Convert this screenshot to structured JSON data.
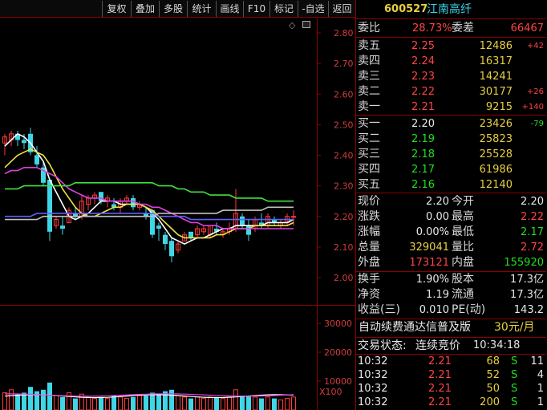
{
  "toolbar": {
    "buttons": [
      "复权",
      "叠加",
      "多股",
      "统计",
      "画线",
      "F10",
      "标记",
      "-自选",
      "返回"
    ]
  },
  "chart_data": {
    "type": "candlestick",
    "price_axis": [
      "2.80",
      "2.70",
      "2.60",
      "2.50",
      "2.40",
      "2.30",
      "2.20",
      "2.10",
      "2.00"
    ],
    "ylim": [
      1.95,
      2.84
    ],
    "volume_axis": [
      "30000",
      "20000",
      "10000"
    ],
    "volume_unit": "X100",
    "volume_max": 35000,
    "candles": [
      {
        "o": 2.44,
        "h": 2.47,
        "l": 2.4,
        "c": 2.46
      },
      {
        "o": 2.45,
        "h": 2.48,
        "l": 2.43,
        "c": 2.47
      },
      {
        "o": 2.47,
        "h": 2.48,
        "l": 2.43,
        "c": 2.45
      },
      {
        "o": 2.45,
        "h": 2.47,
        "l": 2.42,
        "c": 2.44
      },
      {
        "o": 2.47,
        "h": 2.49,
        "l": 2.4,
        "c": 2.41
      },
      {
        "o": 2.4,
        "h": 2.43,
        "l": 2.36,
        "c": 2.37
      },
      {
        "o": 2.36,
        "h": 2.38,
        "l": 2.3,
        "c": 2.31
      },
      {
        "o": 2.32,
        "h": 2.32,
        "l": 2.12,
        "c": 2.15
      },
      {
        "o": 2.17,
        "h": 2.2,
        "l": 2.16,
        "c": 2.19
      },
      {
        "o": 2.17,
        "h": 2.2,
        "l": 2.14,
        "c": 2.16
      },
      {
        "o": 2.18,
        "h": 2.23,
        "l": 2.18,
        "c": 2.22
      },
      {
        "o": 2.21,
        "h": 2.23,
        "l": 2.19,
        "c": 2.2
      },
      {
        "o": 2.2,
        "h": 2.27,
        "l": 2.19,
        "c": 2.25
      },
      {
        "o": 2.24,
        "h": 2.27,
        "l": 2.22,
        "c": 2.26
      },
      {
        "o": 2.26,
        "h": 2.28,
        "l": 2.24,
        "c": 2.27
      },
      {
        "o": 2.28,
        "h": 2.28,
        "l": 2.24,
        "c": 2.25
      },
      {
        "o": 2.25,
        "h": 2.27,
        "l": 2.23,
        "c": 2.26
      },
      {
        "o": 2.24,
        "h": 2.26,
        "l": 2.22,
        "c": 2.23
      },
      {
        "o": 2.23,
        "h": 2.26,
        "l": 2.21,
        "c": 2.25
      },
      {
        "o": 2.25,
        "h": 2.27,
        "l": 2.24,
        "c": 2.26
      },
      {
        "o": 2.26,
        "h": 2.27,
        "l": 2.22,
        "c": 2.23
      },
      {
        "o": 2.23,
        "h": 2.25,
        "l": 2.22,
        "c": 2.24
      },
      {
        "o": 2.21,
        "h": 2.23,
        "l": 2.19,
        "c": 2.2
      },
      {
        "o": 2.22,
        "h": 2.22,
        "l": 2.13,
        "c": 2.14
      },
      {
        "o": 2.17,
        "h": 2.18,
        "l": 2.12,
        "c": 2.16
      },
      {
        "o": 2.14,
        "h": 2.15,
        "l": 2.09,
        "c": 2.11
      },
      {
        "o": 2.12,
        "h": 2.13,
        "l": 2.05,
        "c": 2.07
      },
      {
        "o": 2.09,
        "h": 2.12,
        "l": 2.08,
        "c": 2.11
      },
      {
        "o": 2.12,
        "h": 2.15,
        "l": 2.12,
        "c": 2.14
      },
      {
        "o": 2.15,
        "h": 2.15,
        "l": 2.12,
        "c": 2.13
      },
      {
        "o": 2.14,
        "h": 2.17,
        "l": 2.13,
        "c": 2.16
      },
      {
        "o": 2.15,
        "h": 2.17,
        "l": 2.14,
        "c": 2.16
      },
      {
        "o": 2.14,
        "h": 2.17,
        "l": 2.13,
        "c": 2.17
      },
      {
        "o": 2.16,
        "h": 2.18,
        "l": 2.14,
        "c": 2.15
      },
      {
        "o": 2.14,
        "h": 2.16,
        "l": 2.13,
        "c": 2.15
      },
      {
        "o": 2.15,
        "h": 2.18,
        "l": 2.14,
        "c": 2.16
      },
      {
        "o": 2.16,
        "h": 2.29,
        "l": 2.15,
        "c": 2.21
      },
      {
        "o": 2.2,
        "h": 2.21,
        "l": 2.16,
        "c": 2.17
      },
      {
        "o": 2.17,
        "h": 2.19,
        "l": 2.12,
        "c": 2.14
      },
      {
        "o": 2.16,
        "h": 2.2,
        "l": 2.15,
        "c": 2.19
      },
      {
        "o": 2.18,
        "h": 2.21,
        "l": 2.16,
        "c": 2.17
      },
      {
        "o": 2.17,
        "h": 2.21,
        "l": 2.16,
        "c": 2.2
      },
      {
        "o": 2.19,
        "h": 2.2,
        "l": 2.17,
        "c": 2.18
      },
      {
        "o": 2.17,
        "h": 2.19,
        "l": 2.16,
        "c": 2.18
      },
      {
        "o": 2.18,
        "h": 2.21,
        "l": 2.17,
        "c": 2.2
      },
      {
        "o": 2.2,
        "h": 2.22,
        "l": 2.17,
        "c": 2.2
      }
    ],
    "ma": [
      {
        "color": "#ffffff",
        "values": [
          2.43,
          2.45,
          2.47,
          2.46,
          2.44,
          2.41,
          2.38,
          2.32,
          2.28,
          2.24,
          2.2,
          2.19,
          2.2,
          2.21,
          2.23,
          2.25,
          2.25,
          2.25,
          2.24,
          2.24,
          2.24,
          2.24,
          2.23,
          2.21,
          2.19,
          2.16,
          2.13,
          2.12,
          2.11,
          2.12,
          2.13,
          2.13,
          2.14,
          2.15,
          2.16,
          2.16,
          2.17,
          2.17,
          2.17,
          2.17,
          2.17,
          2.18,
          2.18,
          2.18,
          2.18,
          2.19
        ]
      },
      {
        "color": "#f0e040",
        "values": [
          2.36,
          2.38,
          2.4,
          2.41,
          2.42,
          2.41,
          2.4,
          2.37,
          2.33,
          2.29,
          2.26,
          2.23,
          2.21,
          2.2,
          2.2,
          2.21,
          2.22,
          2.23,
          2.23,
          2.24,
          2.24,
          2.24,
          2.23,
          2.22,
          2.2,
          2.18,
          2.16,
          2.14,
          2.13,
          2.13,
          2.13,
          2.13,
          2.13,
          2.14,
          2.14,
          2.15,
          2.16,
          2.16,
          2.16,
          2.17,
          2.17,
          2.17,
          2.17,
          2.17,
          2.17,
          2.18
        ]
      },
      {
        "color": "#e040e0",
        "values": [
          2.34,
          2.35,
          2.35,
          2.36,
          2.36,
          2.36,
          2.35,
          2.34,
          2.33,
          2.31,
          2.29,
          2.28,
          2.27,
          2.26,
          2.26,
          2.26,
          2.25,
          2.25,
          2.25,
          2.25,
          2.25,
          2.24,
          2.24,
          2.23,
          2.23,
          2.22,
          2.21,
          2.2,
          2.19,
          2.18,
          2.18,
          2.17,
          2.17,
          2.17,
          2.16,
          2.16,
          2.16,
          2.16,
          2.16,
          2.16,
          2.16,
          2.16,
          2.16,
          2.16,
          2.16,
          2.16
        ]
      },
      {
        "color": "#40e040",
        "values": [
          2.29,
          2.29,
          2.29,
          2.3,
          2.3,
          2.3,
          2.3,
          2.3,
          2.3,
          2.3,
          2.3,
          2.31,
          2.31,
          2.31,
          2.31,
          2.31,
          2.31,
          2.31,
          2.31,
          2.31,
          2.31,
          2.31,
          2.31,
          2.31,
          2.3,
          2.3,
          2.3,
          2.29,
          2.29,
          2.28,
          2.28,
          2.28,
          2.27,
          2.27,
          2.27,
          2.27,
          2.26,
          2.26,
          2.26,
          2.26,
          2.26,
          2.25,
          2.25,
          2.25,
          2.25,
          2.25
        ]
      },
      {
        "color": "#6060ff",
        "values": [
          2.2,
          2.2,
          2.2,
          2.2,
          2.2,
          2.21,
          2.21,
          2.21,
          2.21,
          2.21,
          2.21,
          2.21,
          2.21,
          2.21,
          2.21,
          2.21,
          2.21,
          2.21,
          2.21,
          2.21,
          2.21,
          2.21,
          2.21,
          2.21,
          2.2,
          2.2,
          2.2,
          2.2,
          2.2,
          2.19,
          2.19,
          2.19,
          2.19,
          2.19,
          2.19,
          2.19,
          2.19,
          2.19,
          2.19,
          2.19,
          2.19,
          2.19,
          2.19,
          2.19,
          2.19,
          2.19
        ]
      },
      {
        "color": "#c0c0c0",
        "values": [
          2.19,
          2.19,
          2.19,
          2.19,
          2.19,
          2.19,
          2.2,
          2.2,
          2.2,
          2.2,
          2.2,
          2.2,
          2.2,
          2.2,
          2.2,
          2.2,
          2.2,
          2.2,
          2.2,
          2.2,
          2.2,
          2.2,
          2.2,
          2.2,
          2.21,
          2.21,
          2.21,
          2.21,
          2.21,
          2.21,
          2.21,
          2.21,
          2.21,
          2.21,
          2.22,
          2.22,
          2.22,
          2.22,
          2.22,
          2.22,
          2.22,
          2.23,
          2.23,
          2.23,
          2.23,
          2.23
        ]
      }
    ],
    "volumes": [
      6000,
      7000,
      5500,
      6000,
      8000,
      6500,
      7000,
      9500,
      5000,
      4500,
      6000,
      4000,
      5500,
      4500,
      4000,
      4500,
      4000,
      5000,
      4500,
      4000,
      4500,
      5000,
      5000,
      6000,
      5500,
      6500,
      7000,
      5000,
      4500,
      4000,
      4500,
      4000,
      4500,
      4500,
      4000,
      4500,
      7000,
      5000,
      5000,
      4500,
      4000,
      4500,
      4000,
      3500,
      4000,
      4500
    ]
  },
  "quote": {
    "code": "600527",
    "name": "江南高纤",
    "weibi_label": "委比",
    "weibi": "28.73%",
    "weicha_label": "委差",
    "weicha": "66467",
    "sells": [
      {
        "label": "卖五",
        "price": "2.25",
        "vol": "12486",
        "chg": "+42"
      },
      {
        "label": "卖四",
        "price": "2.24",
        "vol": "16317",
        "chg": ""
      },
      {
        "label": "卖三",
        "price": "2.23",
        "vol": "14241",
        "chg": ""
      },
      {
        "label": "卖二",
        "price": "2.22",
        "vol": "30177",
        "chg": "+26"
      },
      {
        "label": "卖一",
        "price": "2.21",
        "vol": "9215",
        "chg": "+140"
      }
    ],
    "buys": [
      {
        "label": "买一",
        "price": "2.20",
        "vol": "23426",
        "chg": "-79"
      },
      {
        "label": "买二",
        "price": "2.19",
        "vol": "25823",
        "chg": ""
      },
      {
        "label": "买三",
        "price": "2.18",
        "vol": "25528",
        "chg": ""
      },
      {
        "label": "买四",
        "price": "2.17",
        "vol": "61986",
        "chg": ""
      },
      {
        "label": "买五",
        "price": "2.16",
        "vol": "12140",
        "chg": ""
      }
    ],
    "stats": [
      {
        "l1": "现价",
        "v1": "2.20",
        "c1": "white",
        "l2": "今开",
        "v2": "2.20",
        "c2": "white"
      },
      {
        "l1": "涨跌",
        "v1": "0.00",
        "c1": "white",
        "l2": "最高",
        "v2": "2.22",
        "c2": "red"
      },
      {
        "l1": "涨幅",
        "v1": "0.00%",
        "c1": "white",
        "l2": "最低",
        "v2": "2.17",
        "c2": "green"
      },
      {
        "l1": "总量",
        "v1": "329041",
        "c1": "yellow",
        "l2": "量比",
        "v2": "2.72",
        "c2": "red"
      },
      {
        "l1": "外盘",
        "v1": "173121",
        "c1": "red",
        "l2": "内盘",
        "v2": "155920",
        "c2": "green"
      }
    ],
    "stats2": [
      {
        "l1": "换手",
        "v1": "1.90%",
        "c1": "white",
        "l2": "股本",
        "v2": "17.3亿",
        "c2": "white"
      },
      {
        "l1": "净资",
        "v1": "1.19",
        "c1": "white",
        "l2": "流通",
        "v2": "17.3亿",
        "c2": "white"
      },
      {
        "l1": "收益(三)",
        "v1": "0.010",
        "c1": "white",
        "l2": "PE(动)",
        "v2": "143.2",
        "c2": "white"
      }
    ],
    "ad_text": "自动续费通达信普及版",
    "ad_price": "30元/月",
    "status_label": "交易状态:",
    "status_value": "连续竞价",
    "status_time": "10:34:18",
    "ticks": [
      {
        "time": "10:32",
        "price": "2.21",
        "vol": "68",
        "side": "S",
        "num": "11"
      },
      {
        "time": "10:32",
        "price": "2.21",
        "vol": "52",
        "side": "S",
        "num": "4"
      },
      {
        "time": "10:32",
        "price": "2.21",
        "vol": "50",
        "side": "S",
        "num": "1"
      },
      {
        "time": "10:32",
        "price": "2.21",
        "vol": "200",
        "side": "S",
        "num": "1"
      }
    ]
  }
}
